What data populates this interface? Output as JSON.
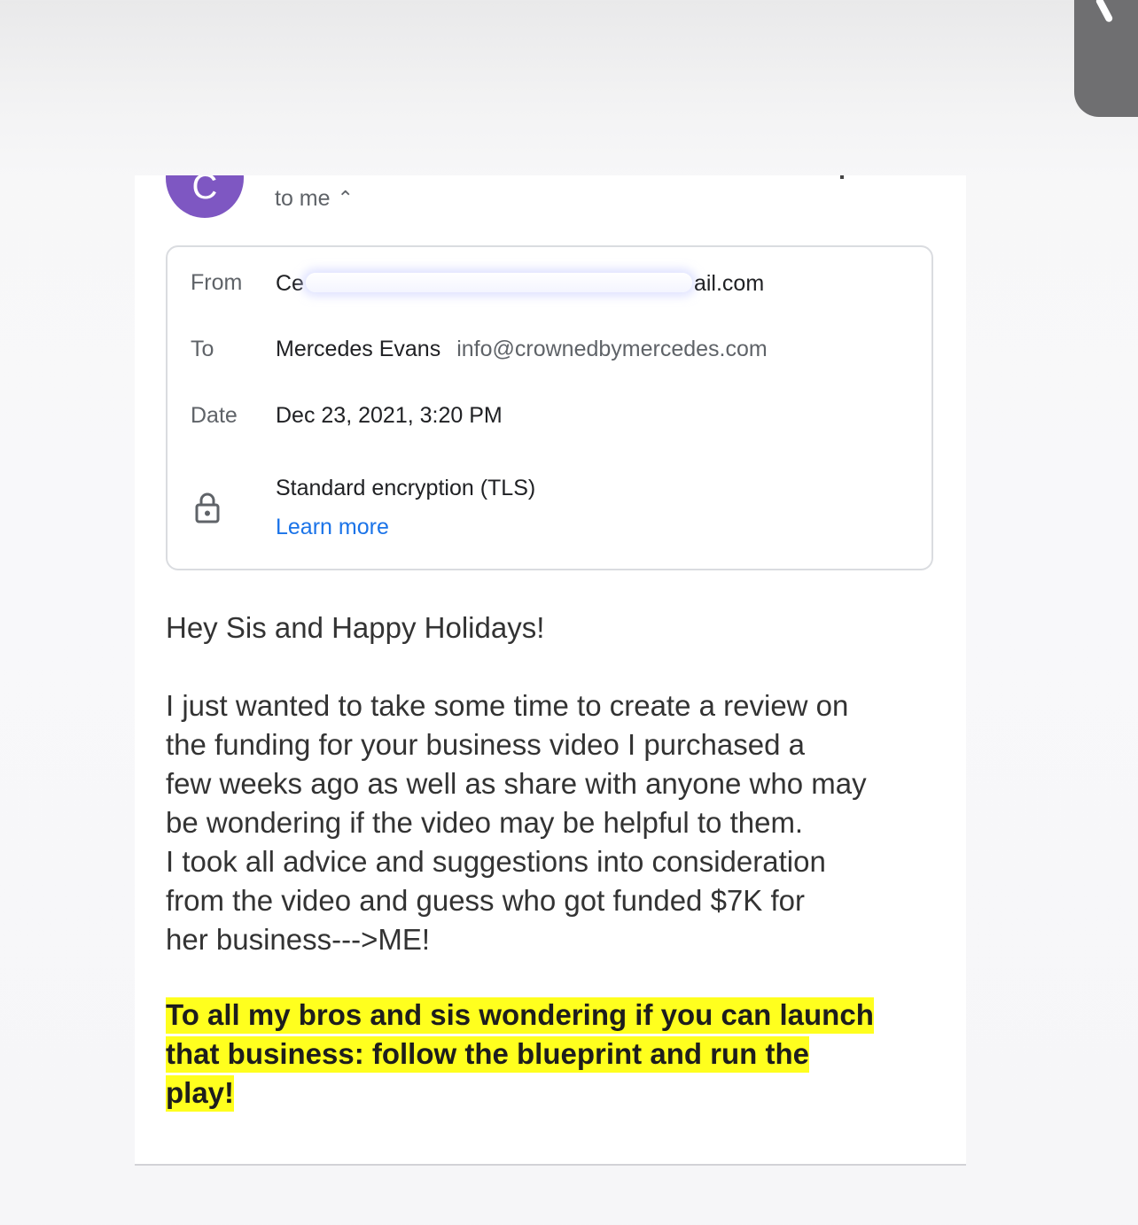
{
  "header": {
    "avatar_letter": "C",
    "recipient_summary": "to me",
    "avatar_color": "#7e57c2"
  },
  "details": {
    "from_label": "From",
    "from_prefix": "Ce",
    "from_suffix": "ail.com",
    "to_label": "To",
    "to_name": "Mercedes Evans",
    "to_email": "info@crownedbymercedes.com",
    "date_label": "Date",
    "date_value": "Dec 23, 2021, 3:20 PM",
    "encryption_text": "Standard encryption (TLS)",
    "learn_more": "Learn more",
    "link_color": "#1a73e8"
  },
  "message": {
    "greeting": "Hey Sis and Happy Holidays!",
    "paragraph1_line1": "I just wanted to take some time to create a review on",
    "paragraph1_line2": "the funding for your business video I purchased a",
    "paragraph1_line3": "few weeks ago as well as share with anyone who may",
    "paragraph1_line4": "be wondering if the video may be helpful to them.",
    "paragraph1_line5": "I took all advice and suggestions into consideration",
    "paragraph1_line6": "from the video and guess who got funded $7K for",
    "paragraph1_line7": "her business--->ME!",
    "highlight_line1": "To all my bros and sis wondering if you can launch",
    "highlight_line2": "that business: follow the blueprint and run the",
    "highlight_line3": "play!",
    "highlight_color": "#ffff1e"
  }
}
